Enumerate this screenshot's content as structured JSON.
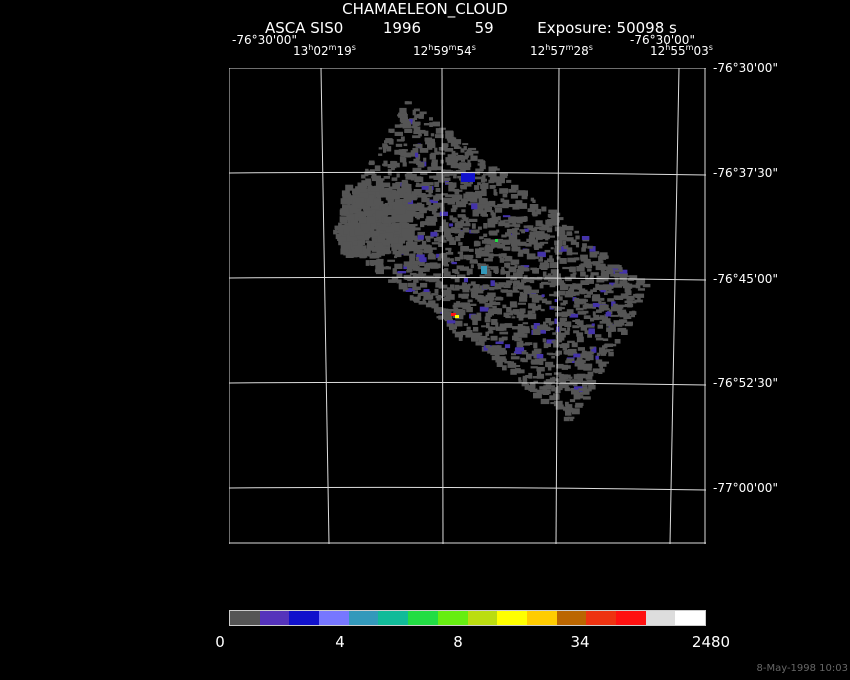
{
  "header": {
    "title": "CHAMAELEON_CLOUD",
    "instrument": "ASCA SIS0",
    "year": "1996",
    "seq": "59",
    "exposure": "Exposure: 50098 s"
  },
  "axes": {
    "top_left_dec": "-76°30'00\"",
    "top_right_dec": "-76°30'00\"",
    "ra_ticks": [
      {
        "h": "13",
        "m": "02",
        "s": "19"
      },
      {
        "h": "12",
        "m": "59",
        "s": "54"
      },
      {
        "h": "12",
        "m": "57",
        "s": "28"
      },
      {
        "h": "12",
        "m": "55",
        "s": "03"
      }
    ],
    "dec_ticks": [
      "-76°30'00\"",
      "-76°37'30\"",
      "-76°45'00\"",
      "-76°52'30\"",
      "-77°00'00\""
    ]
  },
  "colorbar": {
    "colors": [
      "#555555",
      "#5533bb",
      "#1111cc",
      "#7777ff",
      "#3399bb",
      "#11bb99",
      "#22dd44",
      "#66ee11",
      "#bbdd11",
      "#ffff00",
      "#ffcc00",
      "#bb6600",
      "#ee3311",
      "#ff1111",
      "#dddddd",
      "#ffffff"
    ],
    "labels": [
      "0",
      "4",
      "8",
      "34",
      "2480"
    ]
  },
  "footer": {
    "timestamp": "8-May-1998 10:03"
  }
}
